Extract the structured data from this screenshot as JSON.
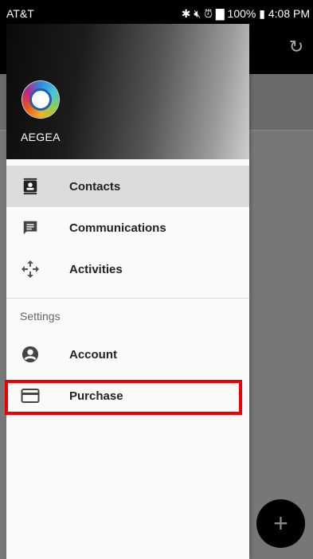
{
  "status_bar": {
    "carrier": "AT&T",
    "battery": "100%",
    "time": "4:08 PM"
  },
  "drawer": {
    "brand": "AEGEA",
    "items": [
      {
        "label": "Contacts",
        "icon": "contacts-icon",
        "active": true
      },
      {
        "label": "Communications",
        "icon": "message-icon"
      },
      {
        "label": "Activities",
        "icon": "move-arrows-icon"
      }
    ],
    "settings_section": "Settings",
    "settings_items": [
      {
        "label": "Account",
        "icon": "account-circle-icon"
      },
      {
        "label": "Purchase",
        "icon": "credit-card-icon"
      }
    ]
  },
  "app": {
    "refresh_icon": "refresh-icon",
    "fab_icon": "plus-icon"
  },
  "colors": {
    "highlight": "#e00000",
    "active_item_bg": "#dcdcdc"
  }
}
